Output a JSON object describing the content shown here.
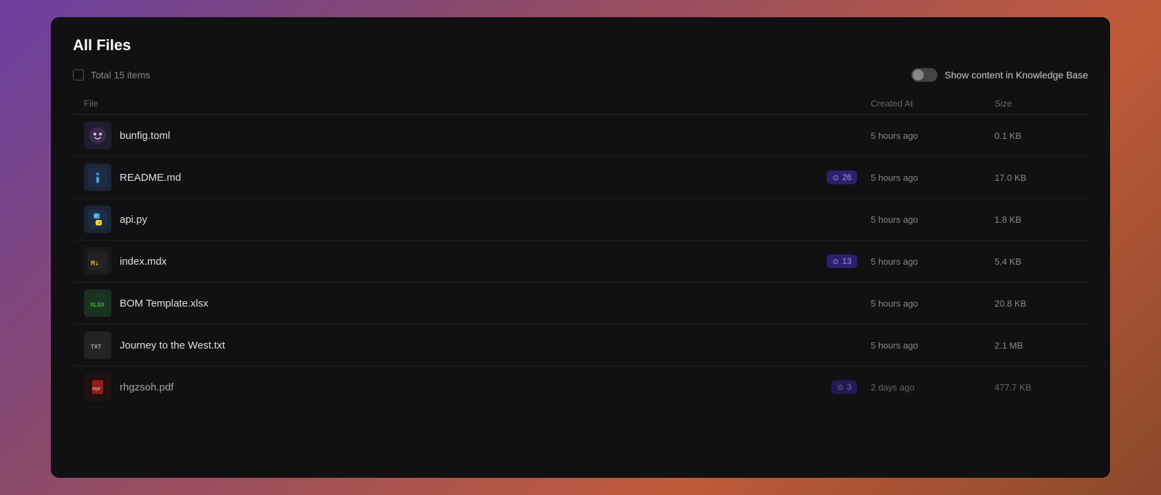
{
  "panel": {
    "title": "All Files",
    "total_label": "Total 15 items",
    "toggle_label": "Show content in Knowledge Base",
    "toggle_enabled": false,
    "columns": {
      "file": "File",
      "created_at": "Created At",
      "size": "Size"
    },
    "files": [
      {
        "id": 1,
        "name": "bunfig.toml",
        "icon_type": "bun",
        "icon_label": "🐰",
        "created_at": "5 hours ago",
        "size": "0.1 KB",
        "badge": null
      },
      {
        "id": 2,
        "name": "README.md",
        "icon_type": "info",
        "icon_label": "ℹ",
        "created_at": "5 hours ago",
        "size": "17.0 KB",
        "badge": "26"
      },
      {
        "id": 3,
        "name": "api.py",
        "icon_type": "python",
        "icon_label": "🐍",
        "created_at": "5 hours ago",
        "size": "1.8 KB",
        "badge": null
      },
      {
        "id": 4,
        "name": "index.mdx",
        "icon_type": "mdx",
        "icon_label": "↓",
        "created_at": "5 hours ago",
        "size": "5.4 KB",
        "badge": "13"
      },
      {
        "id": 5,
        "name": "BOM Template.xlsx",
        "icon_type": "xlsx",
        "icon_label": "xlsx",
        "created_at": "5 hours ago",
        "size": "20.8 KB",
        "badge": null
      },
      {
        "id": 6,
        "name": "Journey to the West.txt",
        "icon_type": "txt",
        "icon_label": "txt",
        "created_at": "5 hours ago",
        "size": "2.1 MB",
        "badge": null
      },
      {
        "id": 7,
        "name": "rhgzsoh.pdf",
        "icon_type": "pdf",
        "icon_label": "pdf",
        "created_at": "2 days ago",
        "size": "477.7 KB",
        "badge": "3"
      }
    ]
  },
  "colors": {
    "badge_bg": "#2d1f6e",
    "badge_text": "#a09de0",
    "accent": "#6c63ff"
  }
}
